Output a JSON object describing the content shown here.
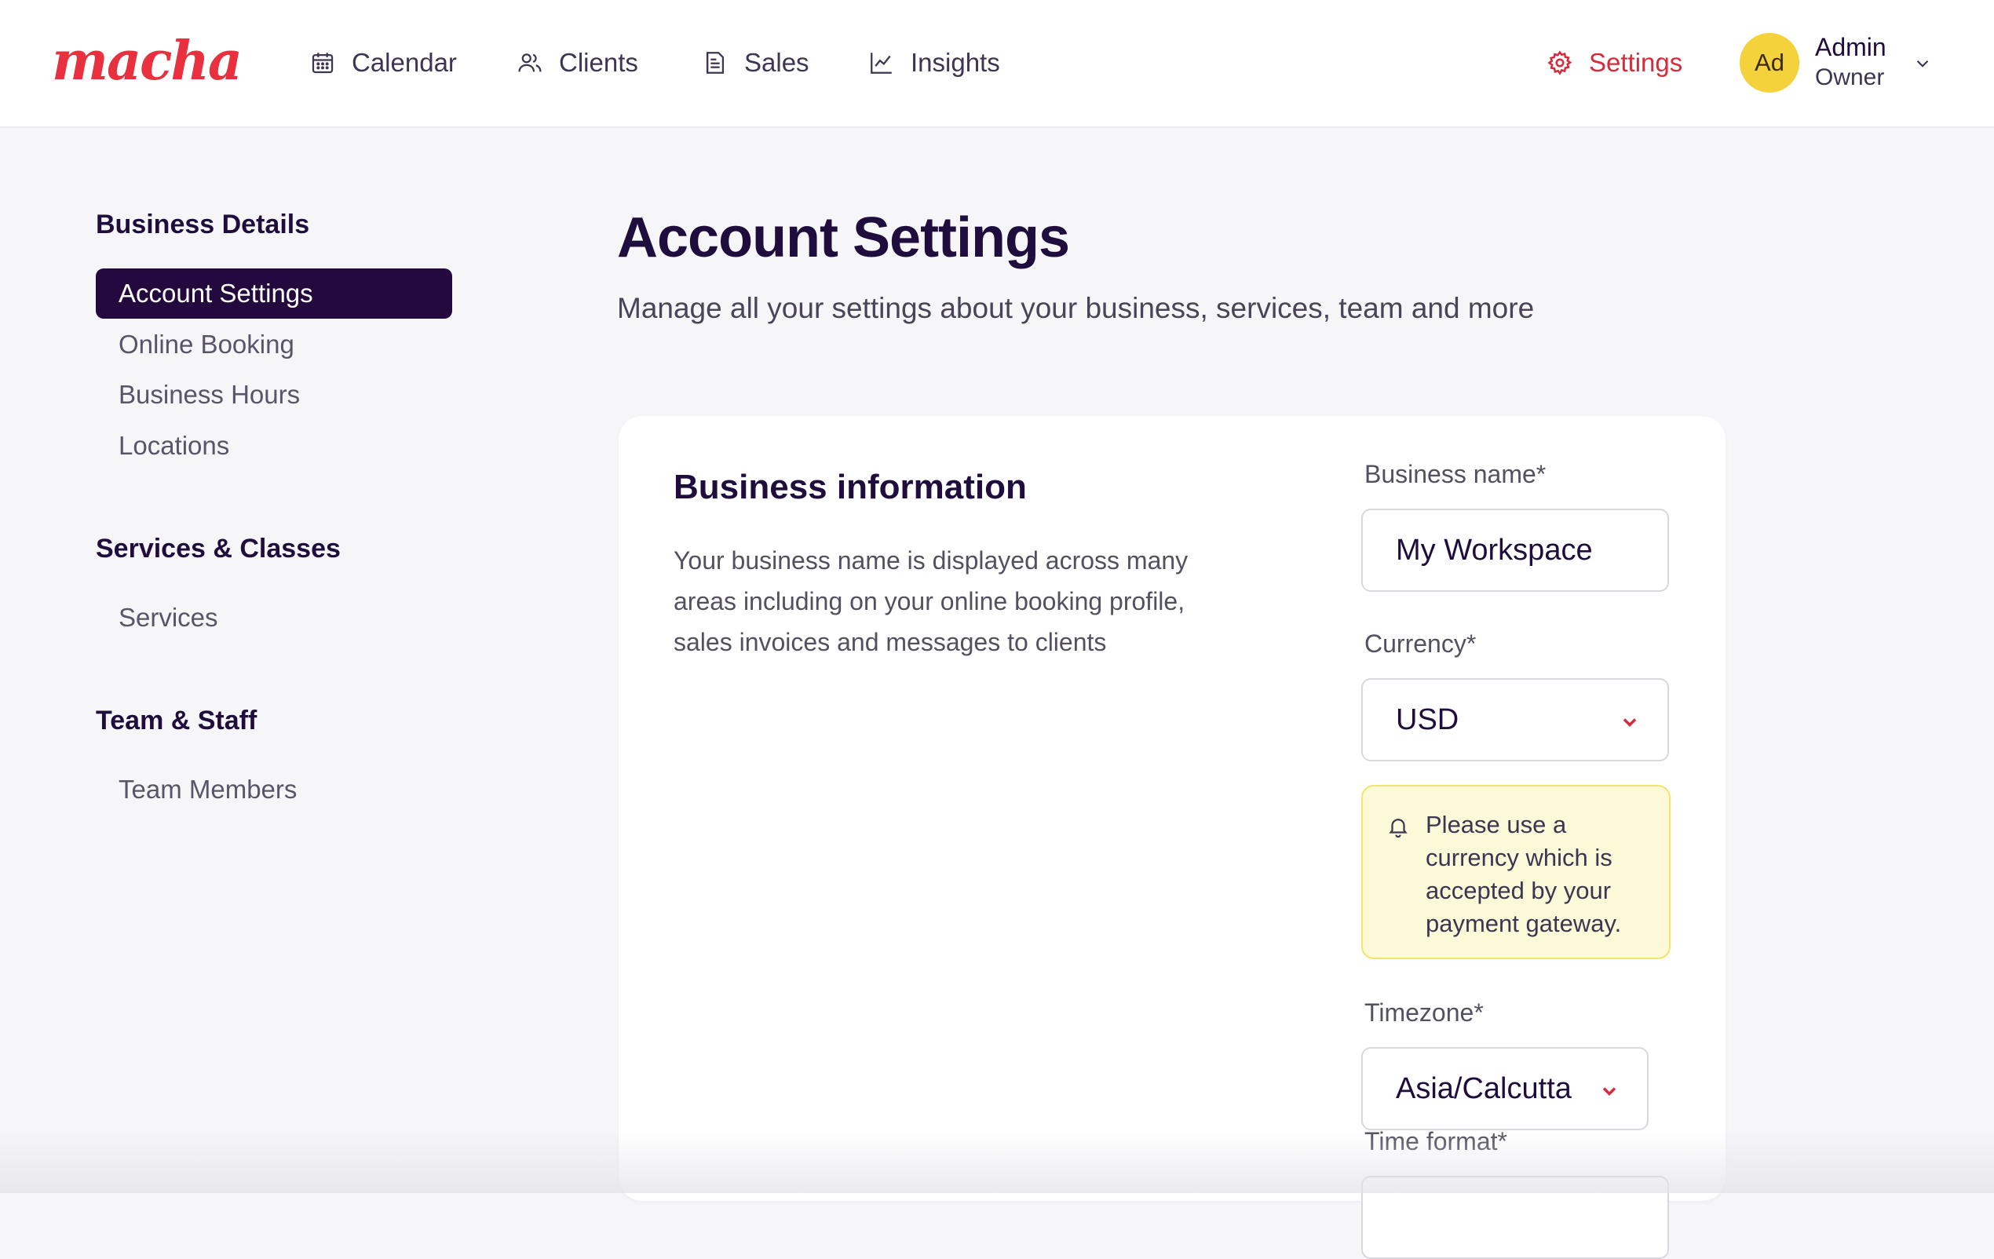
{
  "brand": {
    "logo": "macha"
  },
  "nav": {
    "items": [
      {
        "label": "Calendar",
        "icon": "calendar-icon"
      },
      {
        "label": "Clients",
        "icon": "users-icon"
      },
      {
        "label": "Sales",
        "icon": "receipt-icon"
      },
      {
        "label": "Insights",
        "icon": "chart-line-icon"
      }
    ],
    "settings": {
      "label": "Settings",
      "icon": "gear-icon"
    }
  },
  "user": {
    "initials": "Ad",
    "name": "Admin",
    "role": "Owner"
  },
  "sidebar": {
    "sections": [
      {
        "heading": "Business Details",
        "items": [
          "Account Settings",
          "Online Booking",
          "Business Hours",
          "Locations"
        ]
      },
      {
        "heading": "Services & Classes",
        "items": [
          "Services"
        ]
      },
      {
        "heading": "Team & Staff",
        "items": [
          "Team Members"
        ]
      }
    ],
    "active": "Account Settings"
  },
  "page": {
    "title": "Account Settings",
    "subtitle": "Manage all your settings about your business, services, team and more"
  },
  "business_info": {
    "title": "Business information",
    "description": "Your business name is displayed across many areas including on your online booking profile, sales invoices and messages to clients",
    "business_name_label": "Business name*",
    "business_name_value": "My Workspace",
    "currency_label": "Currency*",
    "currency_value": "USD",
    "currency_notice": "Please use a currency which is accepted by your payment gateway.",
    "timezone_label": "Timezone*",
    "timezone_value": "Asia/Calcutta",
    "time_format_label": "Time format*"
  },
  "colors": {
    "brand_red": "#e8303f",
    "sidebar_active_bg": "#24093f",
    "avatar_bg": "#f4d23c",
    "notice_bg": "#fbf9d7",
    "notice_border": "#f1e56b"
  }
}
